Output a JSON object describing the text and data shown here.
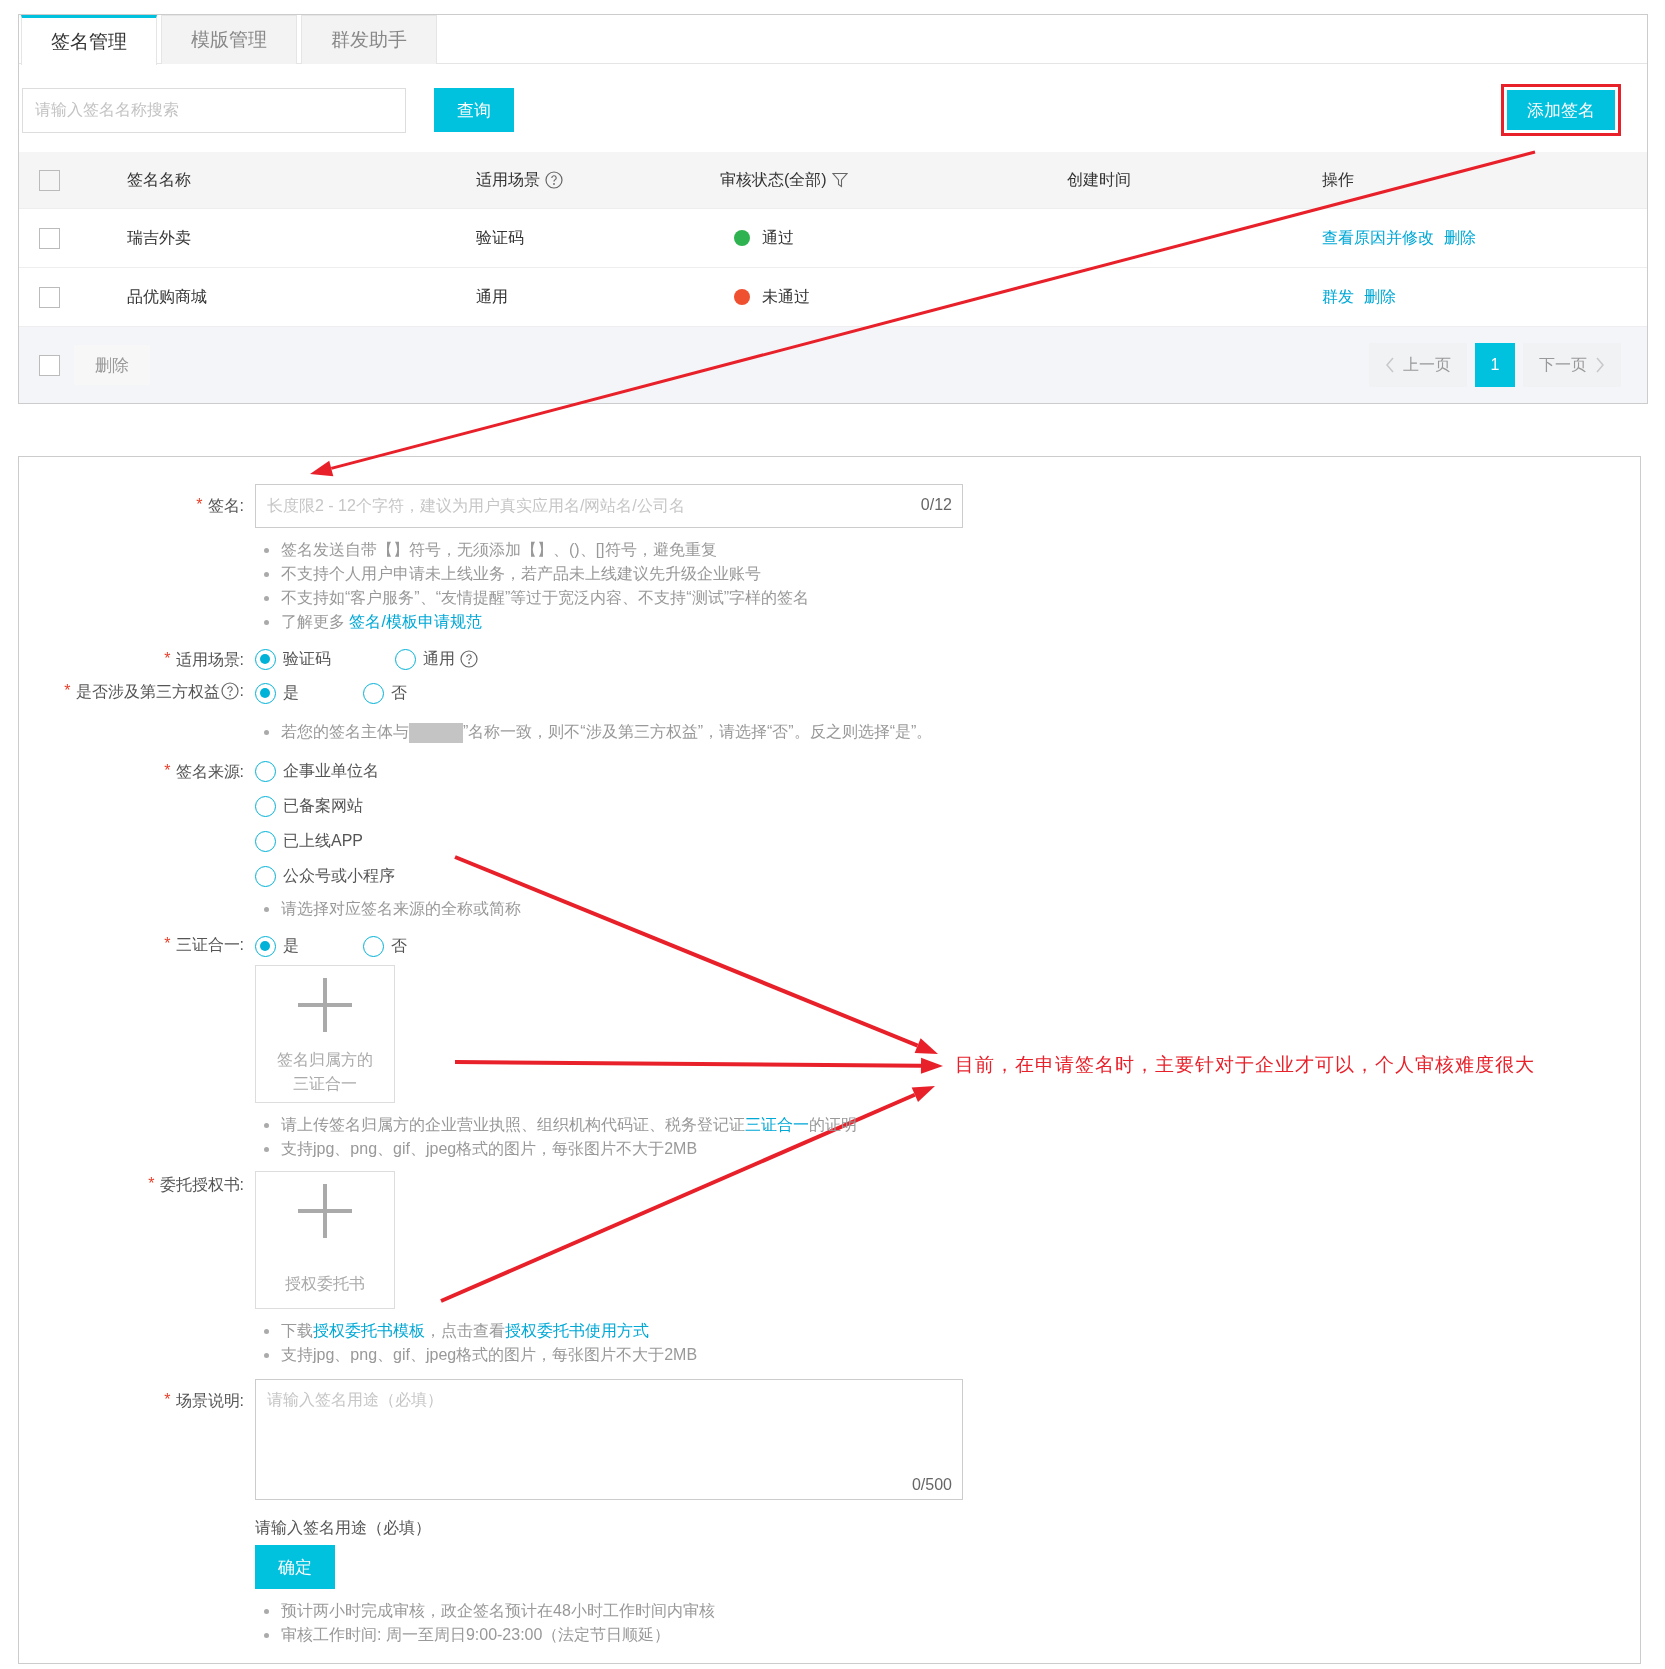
{
  "tabs": [
    {
      "label": "签名管理",
      "selected": true
    },
    {
      "label": "模版管理",
      "selected": false
    },
    {
      "label": "群发助手",
      "selected": false
    }
  ],
  "search": {
    "placeholder": "请输入签名名称搜索"
  },
  "query_button": "查询",
  "add_button": {
    "label": "添加签名",
    "highlighted": true
  },
  "table": {
    "header_checked": false,
    "columns": [
      {
        "label": "签名名称",
        "kind": "plain"
      },
      {
        "label": "适用场景",
        "kind": "help"
      },
      {
        "label": "审核状态(全部)",
        "kind": "filter"
      },
      {
        "label": "创建时间",
        "kind": "plain"
      },
      {
        "label": "操作",
        "kind": "plain"
      }
    ],
    "rows": [
      {
        "checked": false,
        "name": "瑞吉外卖",
        "scene": "验证码",
        "status": "通过",
        "color": "#2fb350",
        "actions": [
          "查看原因并修改",
          "删除"
        ]
      },
      {
        "checked": false,
        "name": "品优购商城",
        "scene": "通用",
        "status": "未通过",
        "color": "#ef5030",
        "actions": [
          "群发",
          "删除"
        ]
      }
    ]
  },
  "footer": {
    "checked": false,
    "delete_button": {
      "label": "删除",
      "disabled": true
    },
    "pagination": [
      {
        "label": "上一页",
        "kind": "prev",
        "disabled": true,
        "selected": false
      },
      {
        "label": "1",
        "kind": "page",
        "disabled": false,
        "selected": true
      },
      {
        "label": "下一页",
        "kind": "next",
        "disabled": true,
        "selected": false
      }
    ]
  },
  "form": {
    "fields": [
      {
        "kind": "input",
        "marker": "*",
        "label": "签名:",
        "placeholder": "长度限2 - 12个字符，建议为用户真实应用名/网站名/公司名",
        "counter": "0/12",
        "hints": [
          [
            {
              "kind": "text",
              "text": "签名发送自带【】符号，无须添加【】、()、[]符号，避免重复"
            }
          ],
          [
            {
              "kind": "text",
              "text": "不支持个人用户申请未上线业务，若产品未上线建议先升级企业账号"
            }
          ],
          [
            {
              "kind": "text",
              "text": "不支持如“客户服务”、“友情提醒”等过于宽泛内容、不支持“测试”字样的签名"
            }
          ],
          [
            {
              "kind": "text",
              "text": "了解更多 "
            },
            {
              "kind": "link",
              "text": "签名/模板申请规范"
            }
          ]
        ]
      },
      {
        "kind": "radio",
        "marker": "*",
        "label": "适用场景:",
        "options": [
          {
            "label": "验证码",
            "selected": true
          },
          {
            "label": "通用",
            "selected": false,
            "help": true
          }
        ]
      },
      {
        "kind": "radio",
        "marker": "*",
        "label": "是否涉及第三方权益",
        "help": true,
        "colon": ":",
        "options": [
          {
            "label": "是",
            "selected": true
          },
          {
            "label": "否",
            "selected": false
          }
        ],
        "hints": [
          [
            {
              "kind": "text",
              "text": "若您的签名主体与"
            },
            {
              "kind": "redacted"
            },
            {
              "kind": "text",
              "text": "”名称一致，则不“涉及第三方权益”，请选择“否”。反之则选择“是”。"
            }
          ]
        ]
      },
      {
        "kind": "radio_list",
        "marker": "*",
        "label": "签名来源:",
        "options": [
          {
            "label": "企事业单位名",
            "selected": false
          },
          {
            "label": "已备案网站",
            "selected": false
          },
          {
            "label": "已上线APP",
            "selected": false
          },
          {
            "label": "公众号或小程序",
            "selected": false
          }
        ],
        "hints": [
          [
            {
              "kind": "text",
              "text": "请选择对应签名来源的全称或简称"
            }
          ]
        ]
      },
      {
        "kind": "radio_upload",
        "marker": "*",
        "label": "三证合一:",
        "options": [
          {
            "label": "是",
            "selected": true
          },
          {
            "label": "否",
            "selected": false
          }
        ],
        "upload": [
          "签名归属方的",
          "三证合一"
        ],
        "hints": [
          [
            {
              "kind": "text",
              "text": "请上传签名归属方的企业营业执照、组织机构代码证、税务登记证"
            },
            {
              "kind": "link",
              "text": "三证合一"
            },
            {
              "kind": "text",
              "text": "的证明"
            }
          ],
          [
            {
              "kind": "text",
              "text": "支持jpg、png、gif、jpeg格式的图片，每张图片不大于2MB"
            }
          ]
        ]
      },
      {
        "kind": "upload",
        "marker": "*",
        "label": "委托授权书:",
        "upload": [
          "授权委托书"
        ],
        "hints": [
          [
            {
              "kind": "text",
              "text": "下载"
            },
            {
              "kind": "link",
              "text": "授权委托书模板"
            },
            {
              "kind": "text",
              "text": "，点击查看"
            },
            {
              "kind": "link",
              "text": "授权委托书使用方式"
            }
          ],
          [
            {
              "kind": "text",
              "text": "支持jpg、png、gif、jpeg格式的图片，每张图片不大于2MB"
            }
          ]
        ]
      },
      {
        "kind": "textarea",
        "marker": "*",
        "label": "场景说明:",
        "placeholder": "请输入签名用途（必填）",
        "counter": "0/500"
      }
    ],
    "note": "请输入签名用途（必填）",
    "submit_button": "确定",
    "footer_hints": [
      "预计两小时完成审核，政企签名预计在48小时工作时间内审核",
      "审核工作时间: 周一至周日9:00-23:00（法定节日顺延）"
    ]
  },
  "annotation": {
    "text": "目前，在申请签名时，主要针对于企业才可以，个人审核难度很大"
  }
}
